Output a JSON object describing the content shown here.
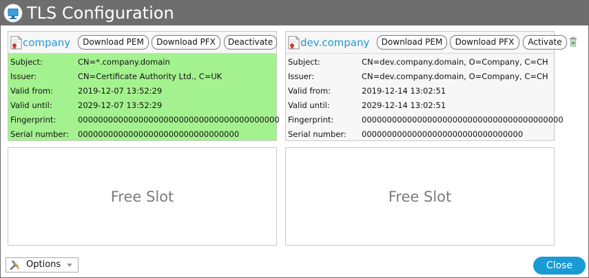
{
  "window": {
    "title": "TLS Configuration"
  },
  "certificates": [
    {
      "name": "company",
      "active": true,
      "buttons": {
        "download_pem": "Download PEM",
        "download_pfx": "Download PFX",
        "toggle": "Deactivate"
      },
      "fields": [
        {
          "label": "Subject:",
          "value": "CN=*.company.domain"
        },
        {
          "label": "Issuer:",
          "value": "CN=Certificate Authority Ltd., C=UK"
        },
        {
          "label": "Valid from:",
          "value": "2019-12-07 13:52:29"
        },
        {
          "label": "Valid until:",
          "value": "2029-12-07 13:52:29"
        },
        {
          "label": "Fingerprint:",
          "value": "0000000000000000000000000000000000000000"
        },
        {
          "label": "Serial number:",
          "value": "00000000000000000000000000000000"
        }
      ]
    },
    {
      "name": "dev.company",
      "active": false,
      "buttons": {
        "download_pem": "Download PEM",
        "download_pfx": "Download PFX",
        "toggle": "Activate"
      },
      "fields": [
        {
          "label": "Subject:",
          "value": "CN=dev.company.domain, O=Company, C=CH"
        },
        {
          "label": "Issuer:",
          "value": "CN=dev.company.domain, O=Company, C=CH"
        },
        {
          "label": "Valid from:",
          "value": "2019-12-14 13:02:51"
        },
        {
          "label": "Valid until:",
          "value": "2029-12-14 13:02:51"
        },
        {
          "label": "Fingerprint:",
          "value": "0000000000000000000000000000000000000000"
        },
        {
          "label": "Serial number:",
          "value": "00000000000000000000000000000000"
        }
      ]
    }
  ],
  "slots": [
    {
      "label": "Free Slot"
    },
    {
      "label": "Free Slot"
    }
  ],
  "footer": {
    "options_label": "Options",
    "close_label": "Close"
  },
  "icons": {
    "app": "monitor-icon",
    "certificate": "certificate-icon",
    "trash": "trash-icon",
    "options": "tools-icon",
    "caret": "chevron-down-icon"
  },
  "colors": {
    "titlebar": "#6e6e6e",
    "active_card": "#a4f28f",
    "inactive_card": "#f7f7f7",
    "accent": "#1a9bd6",
    "free_slot_text": "#7b7b7b"
  }
}
